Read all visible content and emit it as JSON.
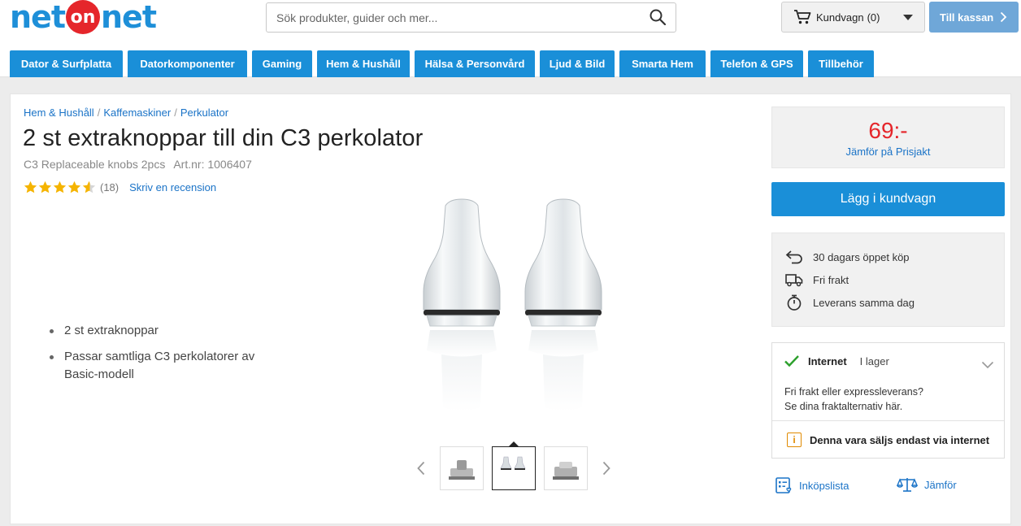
{
  "header": {
    "logo_left": "net",
    "logo_mid": "on",
    "logo_right": "net",
    "search_placeholder": "Sök produkter, guider och mer...",
    "cart_label": "Kundvagn",
    "cart_count": "(0)",
    "checkout_label": "Till kassan"
  },
  "nav": {
    "tabs": [
      {
        "label": "Dator & Surfplatta"
      },
      {
        "label": "Datorkomponenter"
      },
      {
        "label": "Gaming"
      },
      {
        "label": "Hem & Hushåll"
      },
      {
        "label": "Hälsa & Personvård"
      },
      {
        "label": "Ljud & Bild"
      },
      {
        "label": "Smarta Hem"
      },
      {
        "label": "Telefon & GPS"
      },
      {
        "label": "Tillbehör"
      }
    ]
  },
  "breadcrumb": [
    "Hem & Hushåll",
    "Kaffemaskiner",
    "Perkulator"
  ],
  "product": {
    "title": "2 st extraknoppar till din C3 perkolator",
    "subtitle": "C3 Replaceable knobs 2pcs",
    "article": "Art.nr: 1006407",
    "rating_value": 4.5,
    "rating_count": "(18)",
    "review_link": "Skriv en recension",
    "bullets": [
      "2 st extraknoppar",
      "Passar samtliga C3 perkolatorer av Basic-modell"
    ]
  },
  "buy": {
    "price": "69:-",
    "compare_link": "Jämför på Prisjakt",
    "add_to_cart": "Lägg i kundvagn",
    "perks": [
      "30 dagars öppet köp",
      "Fri frakt",
      "Leverans samma dag"
    ]
  },
  "stock": {
    "channel": "Internet",
    "status": "I lager",
    "info_line1": "Fri frakt eller expressleverans?",
    "info_line2": "Se dina fraktalternativ här.",
    "note": "Denna vara säljs endast via internet"
  },
  "actions": {
    "shopping_list": "Inköpslista",
    "compare": "Jämför"
  },
  "colors": {
    "brand_blue": "#1a8fd8",
    "price_red": "#e5262b",
    "link_blue": "#1a73c7",
    "stock_green": "#2ca02c",
    "warning_orange": "#e08a00"
  },
  "icons": [
    "search-icon",
    "cart-icon",
    "chevron-right-icon",
    "star-icon",
    "return-icon",
    "truck-icon",
    "stopwatch-icon",
    "check-icon",
    "chevron-down-icon",
    "info-icon",
    "list-icon",
    "scale-icon"
  ]
}
